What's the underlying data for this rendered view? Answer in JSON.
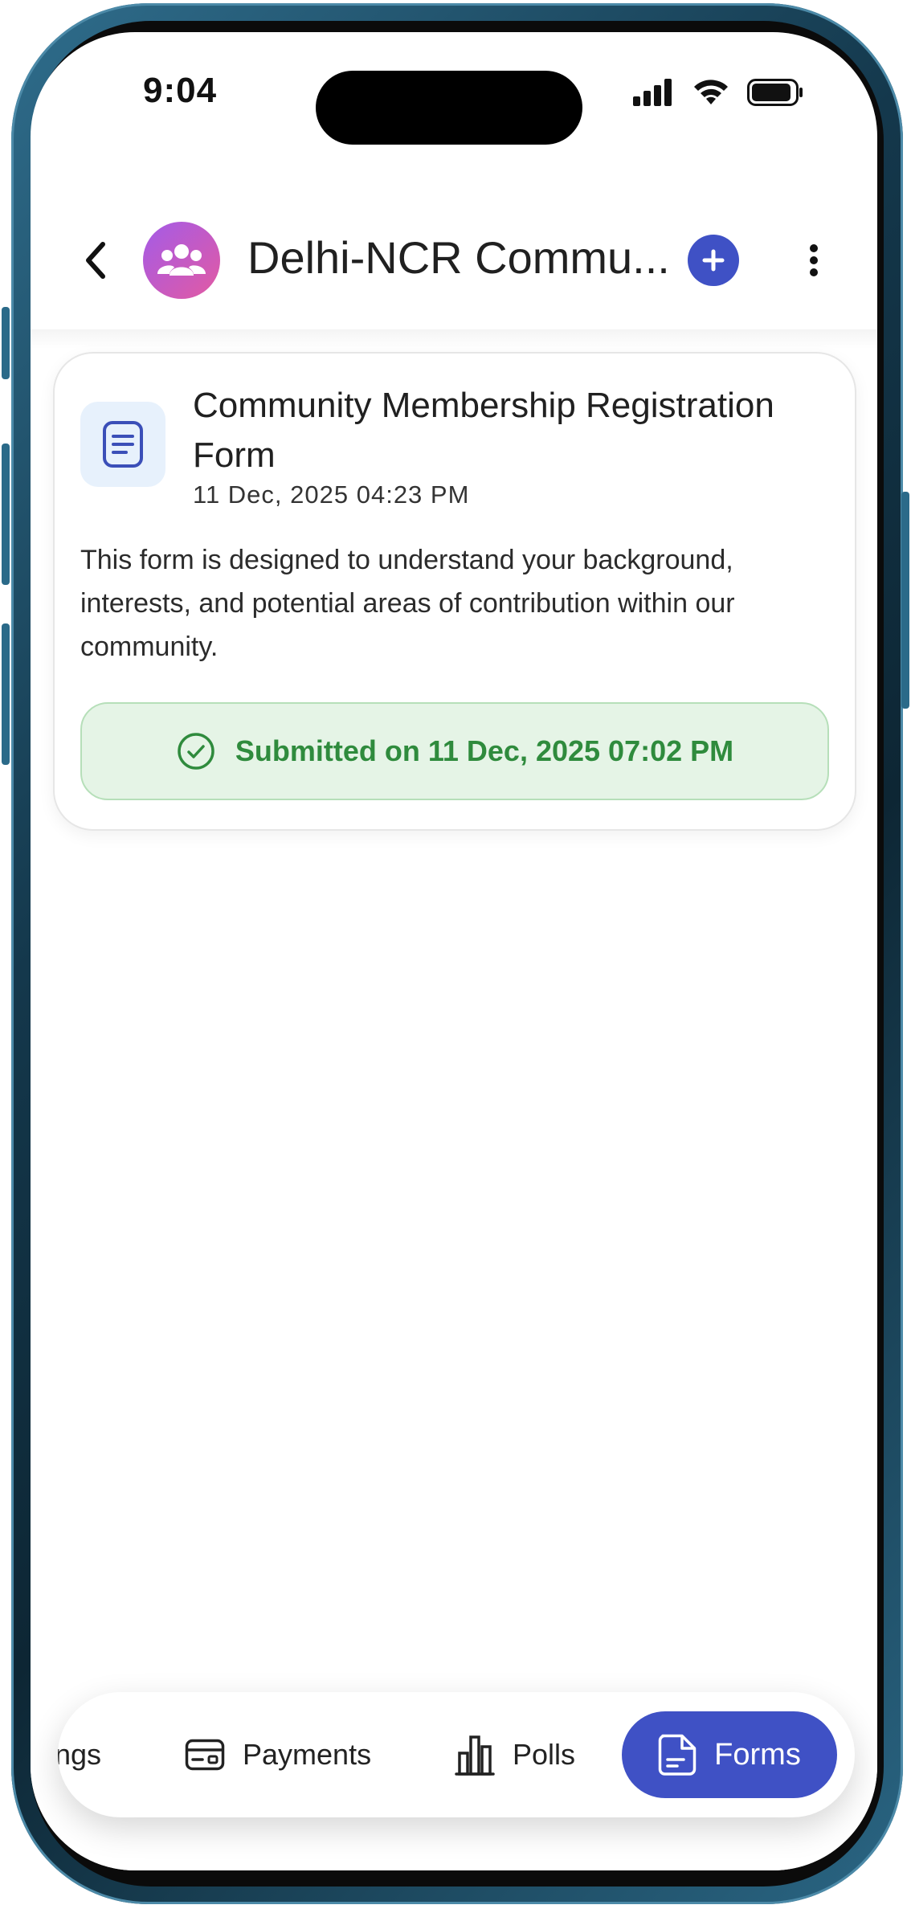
{
  "status_bar": {
    "time": "9:04"
  },
  "header": {
    "title": "Delhi-NCR Commu...",
    "back_icon": "chevron-left-icon",
    "avatar_icon": "group-icon",
    "add_icon": "plus-icon",
    "more_icon": "more-vertical-icon"
  },
  "form_card": {
    "title": "Community Membership Registration Form",
    "date": "11 Dec, 2025 04:23 PM",
    "description": "This form is designed to understand your background, interests, and potential areas of contribution within our community.",
    "status_text": "Submitted on 11 Dec, 2025 07:02 PM",
    "status_color": "#2f8b3d"
  },
  "bottom_nav": {
    "items": [
      {
        "label": "ngs",
        "icon": "settings-icon"
      },
      {
        "label": "Payments",
        "icon": "card-icon"
      },
      {
        "label": "Polls",
        "icon": "bar-chart-icon"
      },
      {
        "label": "Forms",
        "icon": "form-icon",
        "active": true
      }
    ]
  },
  "colors": {
    "accent": "#3f51c5",
    "success_bg": "#e5f4e6"
  }
}
